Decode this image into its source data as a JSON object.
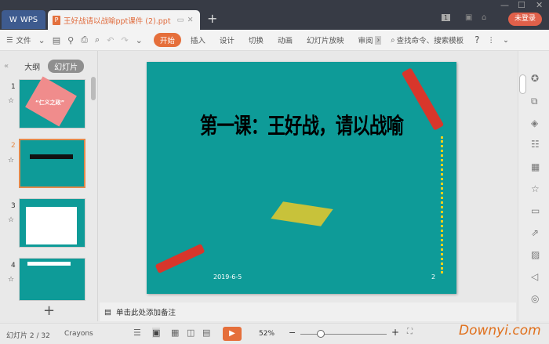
{
  "titlebar": {
    "wps_label": "WPS",
    "doc_tab": "王好战请以战喻ppt课件 (2).ppt",
    "new_tab": "+",
    "badge": "1",
    "login": "未登录"
  },
  "toolbar": {
    "menu": "文件",
    "start": "开始",
    "tabs": [
      "插入",
      "设计",
      "切换",
      "动画",
      "幻灯片放映",
      "审阅"
    ],
    "search": "查找命令、搜索模板",
    "help": "?"
  },
  "left_panel": {
    "outline": "大纲",
    "slides": "幻灯片",
    "thumbs": [
      {
        "num": "1",
        "title": "“仁义之政”"
      },
      {
        "num": "2"
      },
      {
        "num": "3"
      },
      {
        "num": "4"
      }
    ],
    "add": "+"
  },
  "slide": {
    "title": "第一课：王好战，请以战喻",
    "date": "2019-6-5",
    "num": "2"
  },
  "notes": {
    "placeholder": "单击此处添加备注"
  },
  "status": {
    "slide_info": "幻灯片 2 / 32",
    "theme": "Crayons",
    "zoom": "52%",
    "watermark": "Downyi.com"
  },
  "colors": {
    "accent": "#e56f3b",
    "slide_bg": "#0e9b98"
  }
}
